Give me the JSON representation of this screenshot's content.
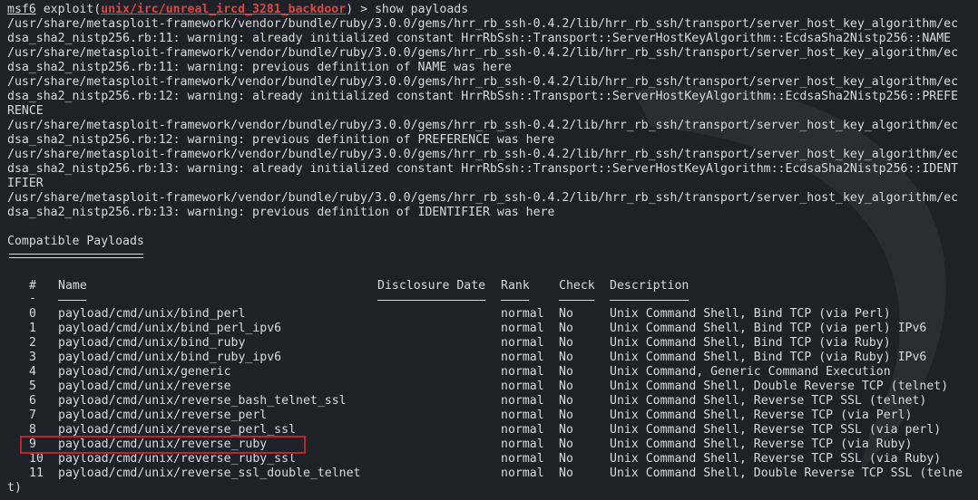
{
  "prompt": {
    "prefix": "msf6",
    "exploit_word": " exploit(",
    "module": "unix/irc/unreal_ircd_3281_backdoor",
    "suffix": ") > show payloads"
  },
  "warnings": [
    "/usr/share/metasploit-framework/vendor/bundle/ruby/3.0.0/gems/hrr_rb_ssh-0.4.2/lib/hrr_rb_ssh/transport/server_host_key_algorithm/ec",
    "dsa_sha2_nistp256.rb:11: warning: already initialized constant HrrRbSsh::Transport::ServerHostKeyAlgorithm::EcdsaSha2Nistp256::NAME",
    "/usr/share/metasploit-framework/vendor/bundle/ruby/3.0.0/gems/hrr_rb_ssh-0.4.2/lib/hrr_rb_ssh/transport/server_host_key_algorithm/ec",
    "dsa_sha2_nistp256.rb:11: warning: previous definition of NAME was here",
    "/usr/share/metasploit-framework/vendor/bundle/ruby/3.0.0/gems/hrr_rb_ssh-0.4.2/lib/hrr_rb_ssh/transport/server_host_key_algorithm/ec",
    "dsa_sha2_nistp256.rb:12: warning: already initialized constant HrrRbSsh::Transport::ServerHostKeyAlgorithm::EcdsaSha2Nistp256::PREFE",
    "RENCE",
    "/usr/share/metasploit-framework/vendor/bundle/ruby/3.0.0/gems/hrr_rb_ssh-0.4.2/lib/hrr_rb_ssh/transport/server_host_key_algorithm/ec",
    "dsa_sha2_nistp256.rb:12: warning: previous definition of PREFERENCE was here",
    "/usr/share/metasploit-framework/vendor/bundle/ruby/3.0.0/gems/hrr_rb_ssh-0.4.2/lib/hrr_rb_ssh/transport/server_host_key_algorithm/ec",
    "dsa_sha2_nistp256.rb:13: warning: already initialized constant HrrRbSsh::Transport::ServerHostKeyAlgorithm::EcdsaSha2Nistp256::IDENT",
    "IFIER",
    "/usr/share/metasploit-framework/vendor/bundle/ruby/3.0.0/gems/hrr_rb_ssh-0.4.2/lib/hrr_rb_ssh/transport/server_host_key_algorithm/ec",
    "dsa_sha2_nistp256.rb:13: warning: previous definition of IDENTIFIER was here"
  ],
  "section_title": "Compatible Payloads",
  "section_underline": "===================",
  "table": {
    "headers": {
      "num": "#",
      "name": "Name",
      "date": "Disclosure Date",
      "rank": "Rank",
      "check": "Check",
      "desc": "Description"
    },
    "dash": "-",
    "rows": [
      {
        "num": "0",
        "name": "payload/cmd/unix/bind_perl",
        "date": "",
        "rank": "normal",
        "check": "No",
        "desc": "Unix Command Shell, Bind TCP (via Perl)"
      },
      {
        "num": "1",
        "name": "payload/cmd/unix/bind_perl_ipv6",
        "date": "",
        "rank": "normal",
        "check": "No",
        "desc": "Unix Command Shell, Bind TCP (via perl) IPv6"
      },
      {
        "num": "2",
        "name": "payload/cmd/unix/bind_ruby",
        "date": "",
        "rank": "normal",
        "check": "No",
        "desc": "Unix Command Shell, Bind TCP (via Ruby)"
      },
      {
        "num": "3",
        "name": "payload/cmd/unix/bind_ruby_ipv6",
        "date": "",
        "rank": "normal",
        "check": "No",
        "desc": "Unix Command Shell, Bind TCP (via Ruby) IPv6"
      },
      {
        "num": "4",
        "name": "payload/cmd/unix/generic",
        "date": "",
        "rank": "normal",
        "check": "No",
        "desc": "Unix Command, Generic Command Execution"
      },
      {
        "num": "5",
        "name": "payload/cmd/unix/reverse",
        "date": "",
        "rank": "normal",
        "check": "No",
        "desc": "Unix Command Shell, Double Reverse TCP (telnet)"
      },
      {
        "num": "6",
        "name": "payload/cmd/unix/reverse_bash_telnet_ssl",
        "date": "",
        "rank": "normal",
        "check": "No",
        "desc": "Unix Command Shell, Reverse TCP SSL (telnet)"
      },
      {
        "num": "7",
        "name": "payload/cmd/unix/reverse_perl",
        "date": "",
        "rank": "normal",
        "check": "No",
        "desc": "Unix Command Shell, Reverse TCP (via Perl)"
      },
      {
        "num": "8",
        "name": "payload/cmd/unix/reverse_perl_ssl",
        "date": "",
        "rank": "normal",
        "check": "No",
        "desc": "Unix Command Shell, Reverse TCP SSL (via perl)"
      },
      {
        "num": "9",
        "name": "payload/cmd/unix/reverse_ruby",
        "date": "",
        "rank": "normal",
        "check": "No",
        "desc": "Unix Command Shell, Reverse TCP (via Ruby)"
      },
      {
        "num": "10",
        "name": "payload/cmd/unix/reverse_ruby_ssl",
        "date": "",
        "rank": "normal",
        "check": "No",
        "desc": "Unix Command Shell, Reverse TCP SSL (via Ruby)"
      },
      {
        "num": "11",
        "name": "payload/cmd/unix/reverse_ssl_double_telnet",
        "date": "",
        "rank": "normal",
        "check": "No",
        "desc": "Unix Command Shell, Double Reverse TCP SSL (telne"
      }
    ],
    "wrap_tail": "t)"
  },
  "colors": {
    "background": "#1e2127",
    "text": "#d6dbe3",
    "module": "#e0463f",
    "highlight_box": "#c0222b"
  },
  "icons": [
    "kali-dragon-wallpaper"
  ]
}
